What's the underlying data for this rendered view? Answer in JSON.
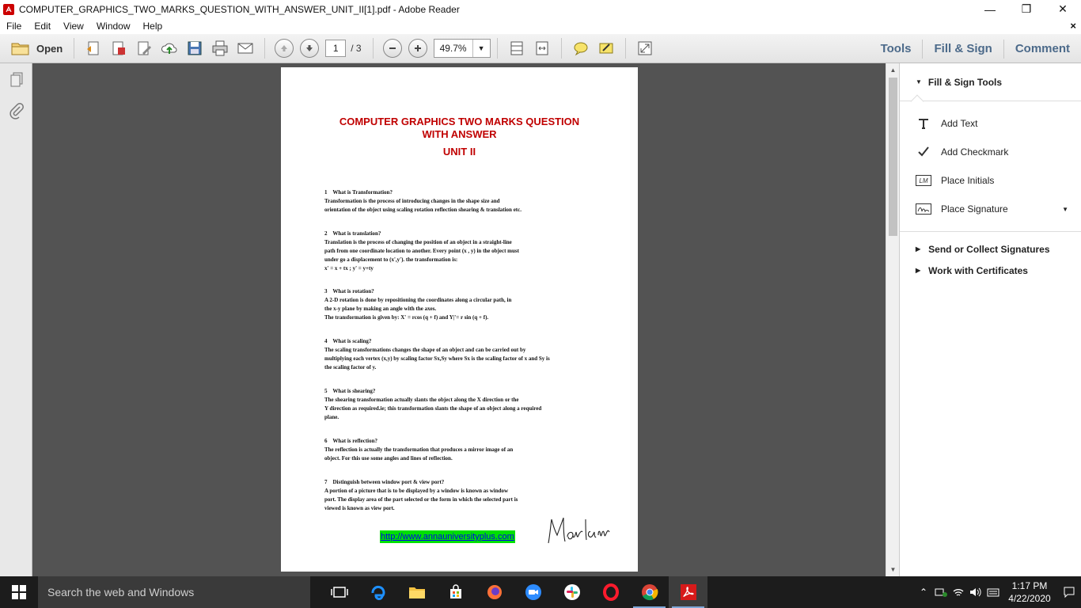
{
  "window": {
    "title": "COMPUTER_GRAPHICS_TWO_MARKS_QUESTION_WITH_ANSWER_UNIT_II[1].pdf - Adobe Reader",
    "minimize": "—",
    "restore": "❒",
    "close": "✕"
  },
  "menu": {
    "items": [
      "File",
      "Edit",
      "View",
      "Window",
      "Help"
    ],
    "close_doc": "×"
  },
  "toolbar": {
    "open_label": "Open",
    "current_page": "1",
    "total_pages": "/ 3",
    "zoom": "49.7%",
    "tabs": [
      "Tools",
      "Fill & Sign",
      "Comment"
    ]
  },
  "document": {
    "title_line1": "COMPUTER GRAPHICS TWO MARKS QUESTION",
    "title_line2": "WITH ANSWER",
    "unit": "UNIT II",
    "questions": [
      {
        "heading": "1    What is Transformation?",
        "lines": [
          "Transformation is the process of introducing changes in the shape size and",
          "orientation of the object using scaling rotation reflection shearing & translation etc."
        ]
      },
      {
        "heading": "2    What is translation?",
        "lines": [
          "Translation is the process of changing the position of an object in a straight-line",
          "path from one coordinate location to another. Every point (x , y) in the object must",
          "under go a displacement to (x',y'). the transformation is:",
          "x' = x + tx ; y' = y+ty"
        ]
      },
      {
        "heading": "3    What is rotation?",
        "lines": [
          "A 2-D rotation is done by repositioning the coordinates along a circular path, in",
          "the x-y plane by making an angle with the axes.",
          "The transformation is given by: X' = rcos (q + f) and Y|'= r sin (q + f)."
        ]
      },
      {
        "heading": "4    What is scaling?",
        "lines": [
          "The scaling transformations changes the shape of an object and can be carried out by",
          "multiplying each vertex (x,y) by scaling factor Sx,Sy where Sx is the scaling factor of x and Sy is",
          "the scaling factor of y."
        ]
      },
      {
        "heading": "5    What is shearing?",
        "lines": [
          "The shearing transformation actually slants the object along the X direction or the",
          "Y direction as required.ie; this transformation slants the shape of an object along a required",
          "plane."
        ]
      },
      {
        "heading": "6    What is reflection?",
        "lines": [
          "The reflection is actually the transformation that produces a mirror image of an",
          "object. For this use some angles and lines of reflection."
        ]
      },
      {
        "heading": "7    Distinguish between window port & view port?",
        "lines": [
          "A portion of a picture that is to be displayed by a window is known as window",
          "port. The display area of the part selected or the form in which the selected part is",
          "viewed is known as view port."
        ]
      }
    ],
    "link": "http://www.annauniversityplus.com",
    "signature": "Mariam"
  },
  "right_pane": {
    "header": "Fill & Sign Tools",
    "tools": [
      "Add Text",
      "Add Checkmark",
      "Place Initials",
      "Place Signature"
    ],
    "sections": [
      "Send or Collect Signatures",
      "Work with Certificates"
    ]
  },
  "taskbar": {
    "search_placeholder": "Search the web and Windows",
    "time": "1:17 PM",
    "date": "4/22/2020"
  },
  "colors": {
    "title_red": "#c00000",
    "tab_blue": "#4c6a8a",
    "doc_bg": "#535353",
    "link_highlight": "#00e000"
  }
}
